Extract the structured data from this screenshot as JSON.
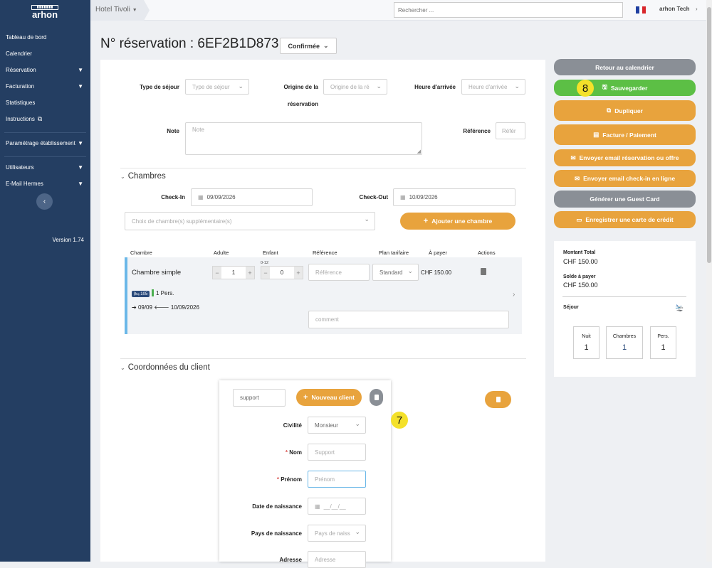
{
  "sidebar": {
    "logo_top": "ARHON",
    "logo_name": "arhon",
    "items": [
      {
        "label": "Tableau de bord",
        "chevron": false
      },
      {
        "label": "Calendrier",
        "chevron": false
      },
      {
        "label": "Réservation",
        "chevron": true
      },
      {
        "label": "Facturation",
        "chevron": true
      },
      {
        "label": "Statistiques",
        "chevron": false
      },
      {
        "label": "Instructions",
        "chevron": false,
        "external": true
      }
    ],
    "items2": [
      {
        "label": "Paramétrage établissement",
        "chevron": true
      }
    ],
    "items3": [
      {
        "label": "Utilisateurs",
        "chevron": true
      },
      {
        "label": "E-Mail Hermes",
        "chevron": true
      }
    ],
    "version": "Version 1.74"
  },
  "topbar": {
    "hotel": "Hotel Tivoli",
    "search_placeholder": "Rechercher ...",
    "user": "arhon Tech"
  },
  "page": {
    "title": "N° réservation : 6EF2B1D873 -",
    "status": "Confirmée"
  },
  "form": {
    "type_sejour_label": "Type de séjour",
    "type_sejour_placeholder": "Type de séjour",
    "origine_label_1": "Origine de la",
    "origine_label_2": "réservation",
    "origine_placeholder": "Origine de la ré",
    "heure_label": "Heure d'arrivée",
    "heure_placeholder": "Heure d'arrivée",
    "note_label": "Note",
    "note_placeholder": "Note",
    "reference_label": "Référence",
    "reference_placeholder": "Référ"
  },
  "chambres": {
    "title": "Chambres",
    "checkin_label": "Check-In",
    "checkin_value": "09/09/2026",
    "checkout_label": "Check-Out",
    "checkout_value": "10/09/2026",
    "choix_placeholder": "Choix de chambre(s) supplémentaire(s)",
    "add_button": "Ajouter une chambre",
    "headers": [
      "Chambre",
      "Adulte",
      "Enfant",
      "Référence",
      "Plan tarifaire",
      "À payer",
      "Actions"
    ],
    "row": {
      "name": "Chambre simple",
      "adulte": "1",
      "enfant_hint": "0-12",
      "enfant": "0",
      "reference_placeholder": "Référence",
      "plan": "Standard",
      "a_payer": "CHF 150.00",
      "badge": "105",
      "pers": "1 Pers.",
      "dates": "09/09",
      "dates_end": "10/09/2026",
      "comment_placeholder": "comment"
    }
  },
  "client": {
    "title": "Coordonnées du client",
    "search_value": "support",
    "new_button": "Nouveau client",
    "civilite_label": "Civilité",
    "civilite_value": "Monsieur",
    "nom_label": "Nom",
    "nom_value": "Support",
    "prenom_label": "Prénom",
    "prenom_placeholder": "Prénom",
    "naissance_label": "Date de naissance",
    "naissance_placeholder": "__/__/__",
    "pays_label": "Pays de naissance",
    "pays_placeholder": "Pays de naiss",
    "adresse_label": "Adresse",
    "adresse_placeholder": "Adresse"
  },
  "actions": {
    "retour": "Retour au calendrier",
    "sauvegarder": "Sauvegarder",
    "dupliquer": "Dupliquer",
    "facture": "Facture / Paiement",
    "email_resa": "Envoyer email réservation ou offre",
    "email_checkin": "Envoyer email check-in en ligne",
    "guest_card": "Générer une Guest Card",
    "carte_credit": "Enregistrer une carte de crédit"
  },
  "summary": {
    "montant_label": "Montant Total",
    "montant_value": "CHF 150.00",
    "solde_label": "Solde à payer",
    "solde_value": "CHF 150.00",
    "sejour_label": "Séjour",
    "nuit_label": "Nuit",
    "nuit_value": "1",
    "chambres_label": "Chambres",
    "chambres_value": "1",
    "pers_label": "Pers.",
    "pers_value": "1"
  },
  "markers": {
    "m7": "7",
    "m8": "8"
  },
  "colors": {
    "sidebar": "#243e62",
    "orange": "#e8a33d",
    "green": "#5cbf45",
    "grey": "#8a8f96",
    "accent": "#6bb8e8"
  }
}
